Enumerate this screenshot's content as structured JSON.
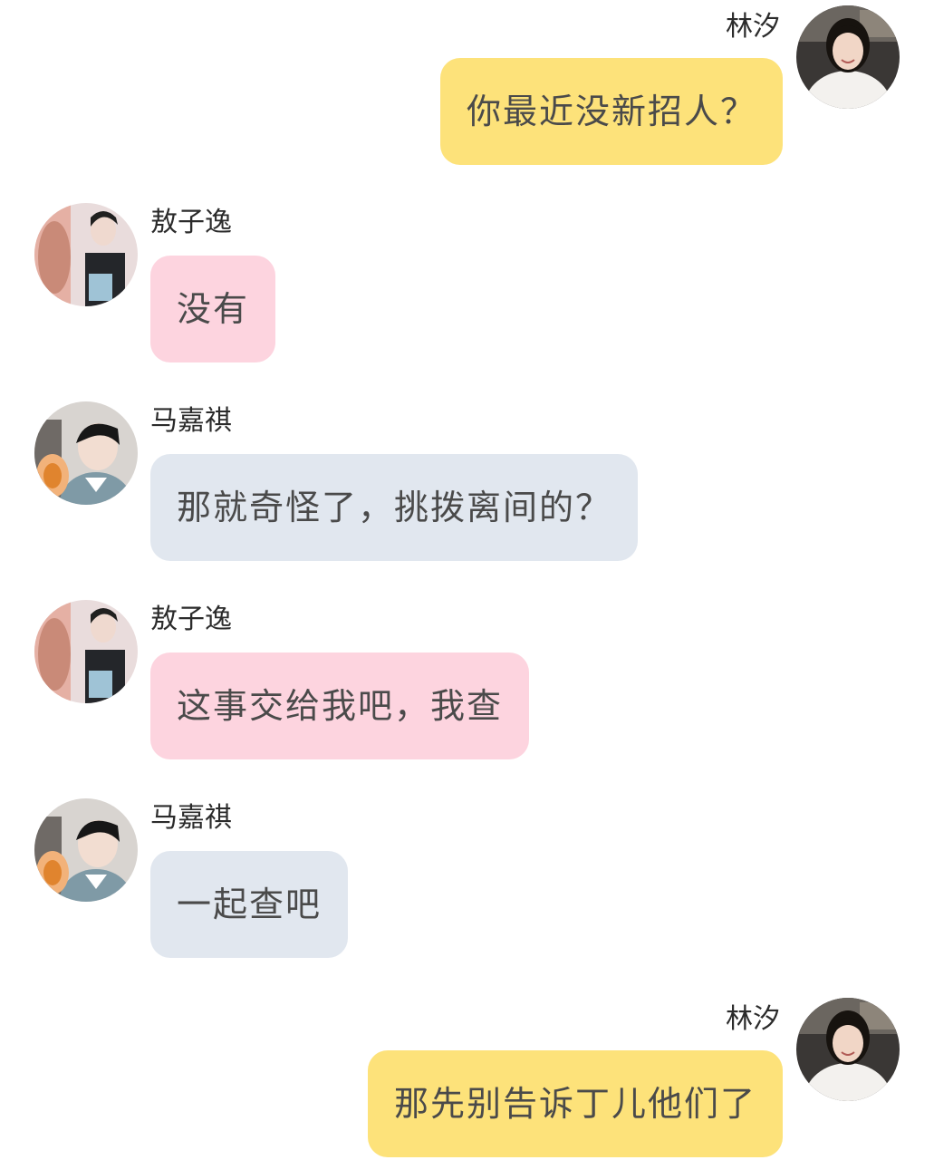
{
  "colors": {
    "self_bubble": "#fde27a",
    "aozi_bubble": "#fdd4df",
    "ma_bubble": "#e1e7ef",
    "background": "#ffffff"
  },
  "messages": [
    {
      "sender": "林汐",
      "text": "你最近没新招人？",
      "side": "right",
      "avatar": "girl-avatar"
    },
    {
      "sender": "敖子逸",
      "text": "没有",
      "side": "left",
      "avatar": "aoziyi-avatar"
    },
    {
      "sender": "马嘉祺",
      "text": "那就奇怪了，挑拨离间的？",
      "side": "left",
      "avatar": "majiaqi-avatar"
    },
    {
      "sender": "敖子逸",
      "text": "这事交给我吧，我查",
      "side": "left",
      "avatar": "aoziyi-avatar"
    },
    {
      "sender": "马嘉祺",
      "text": "一起查吧",
      "side": "left",
      "avatar": "majiaqi-avatar"
    },
    {
      "sender": "林汐",
      "text": "那先别告诉丁儿他们了",
      "side": "right",
      "avatar": "girl-avatar"
    }
  ]
}
